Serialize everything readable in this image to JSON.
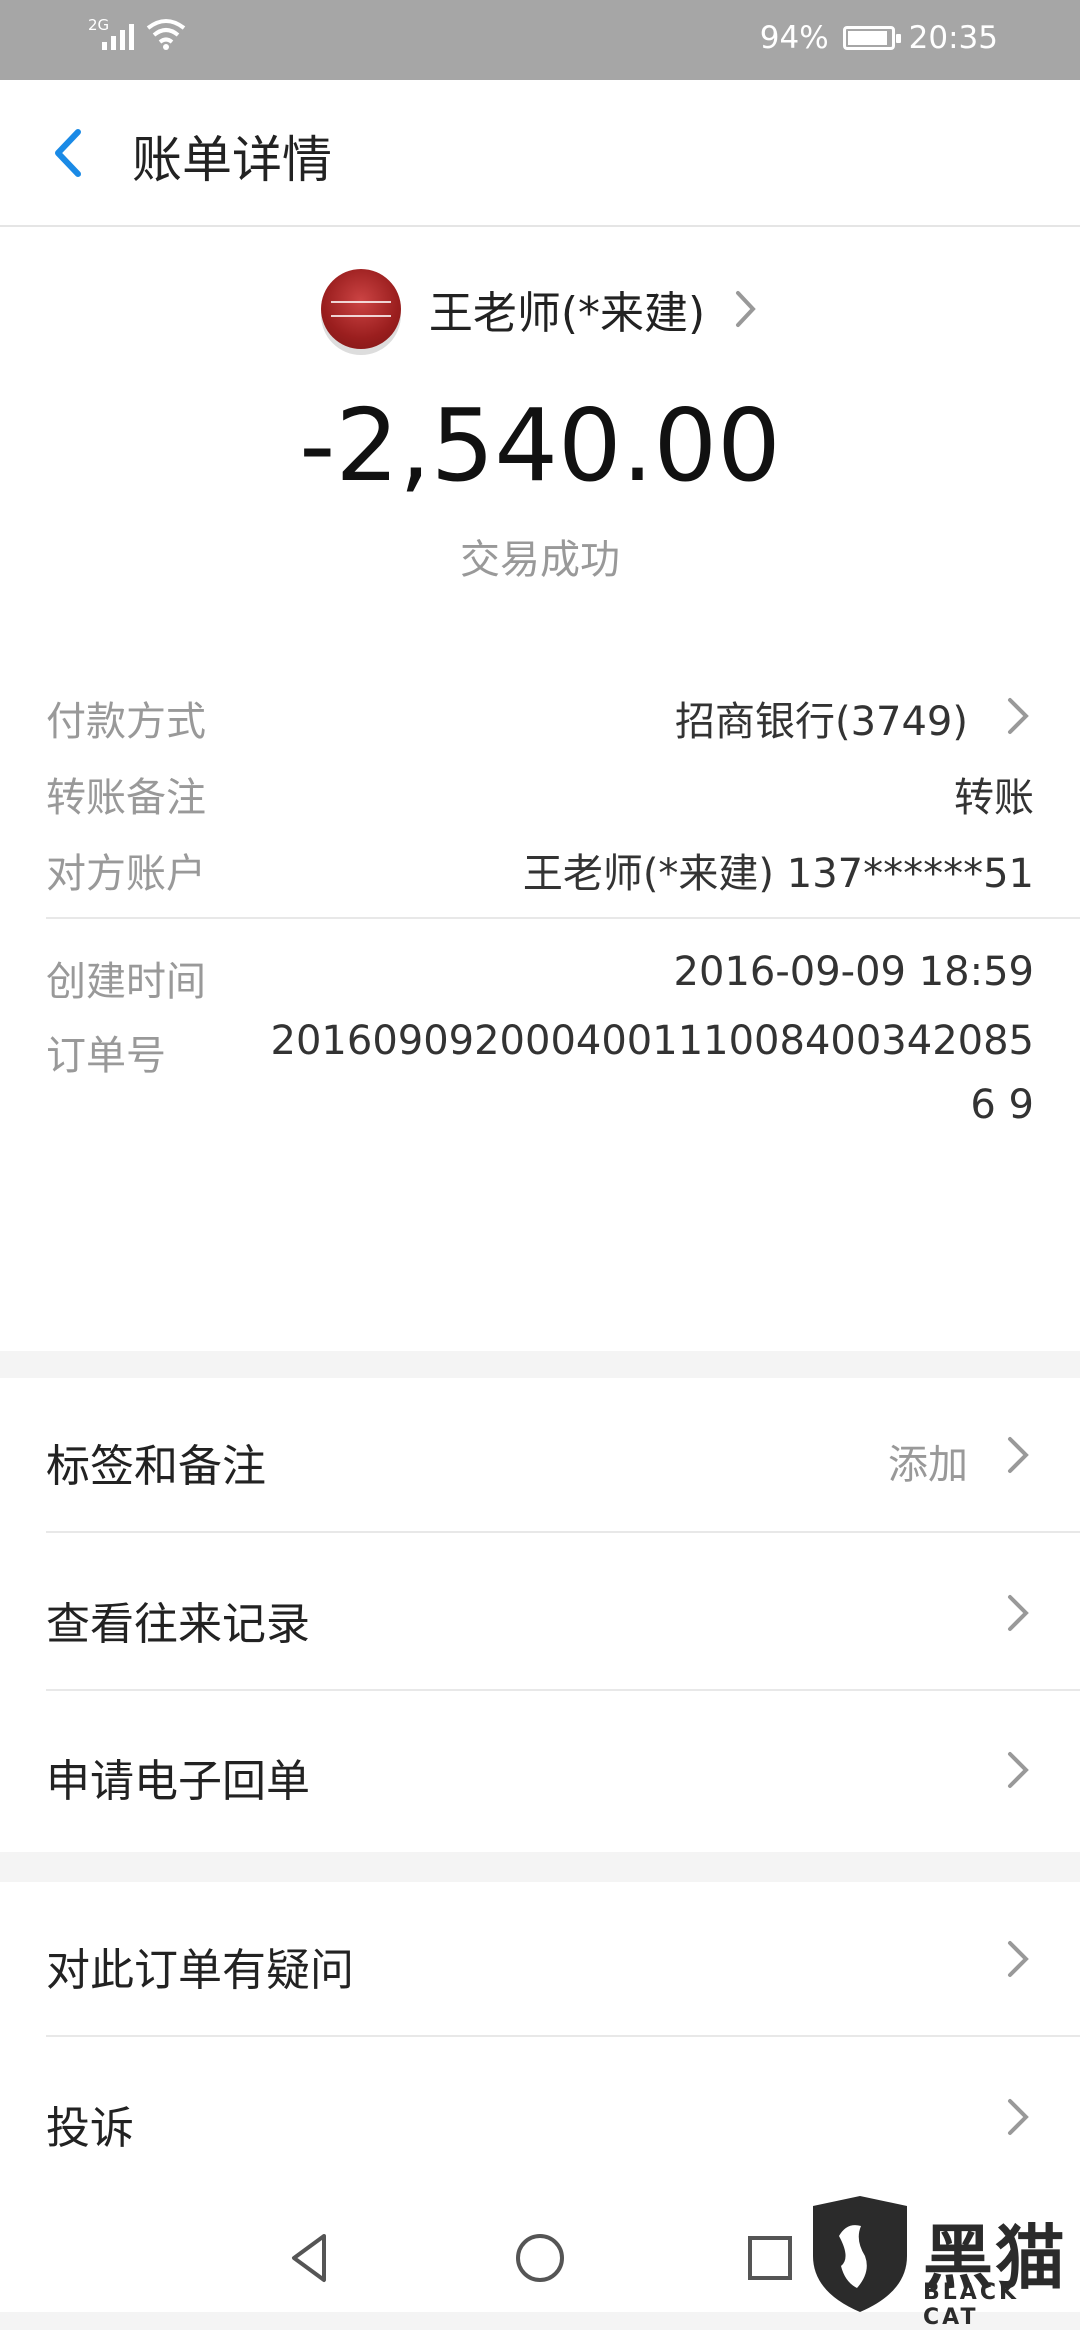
{
  "status_bar": {
    "network_type": "2G",
    "battery": "94%",
    "battery_level": 0.94,
    "time": "20:35"
  },
  "header": {
    "back_icon": "chevron-left-icon",
    "title": "账单详情",
    "accent_color": "#1a8ae6"
  },
  "summary": {
    "payee_name": "王老师(*来建)",
    "amount": "-2,540.00",
    "status": "交易成功"
  },
  "details": {
    "payment_method_label": "付款方式",
    "payment_method_value": "招商银行(3749)",
    "transfer_note_label": "转账备注",
    "transfer_note_value": "转账",
    "counterparty_label": "对方账户",
    "counterparty_value": "王老师(*来建) 137******51",
    "created_time_label": "创建时间",
    "created_time_value": "2016-09-09 18:59",
    "order_number_label": "订单号",
    "order_number_value": "2016090920004001110084003420856 9"
  },
  "menu": {
    "tags_notes": "标签和备注",
    "tags_notes_action": "添加",
    "history": "查看往来记录",
    "e_receipt": "申请电子回单",
    "order_question": "对此订单有疑问",
    "complaint": "投诉"
  },
  "watermark": {
    "text": "黑猫",
    "sub": "BLACK CAT"
  }
}
